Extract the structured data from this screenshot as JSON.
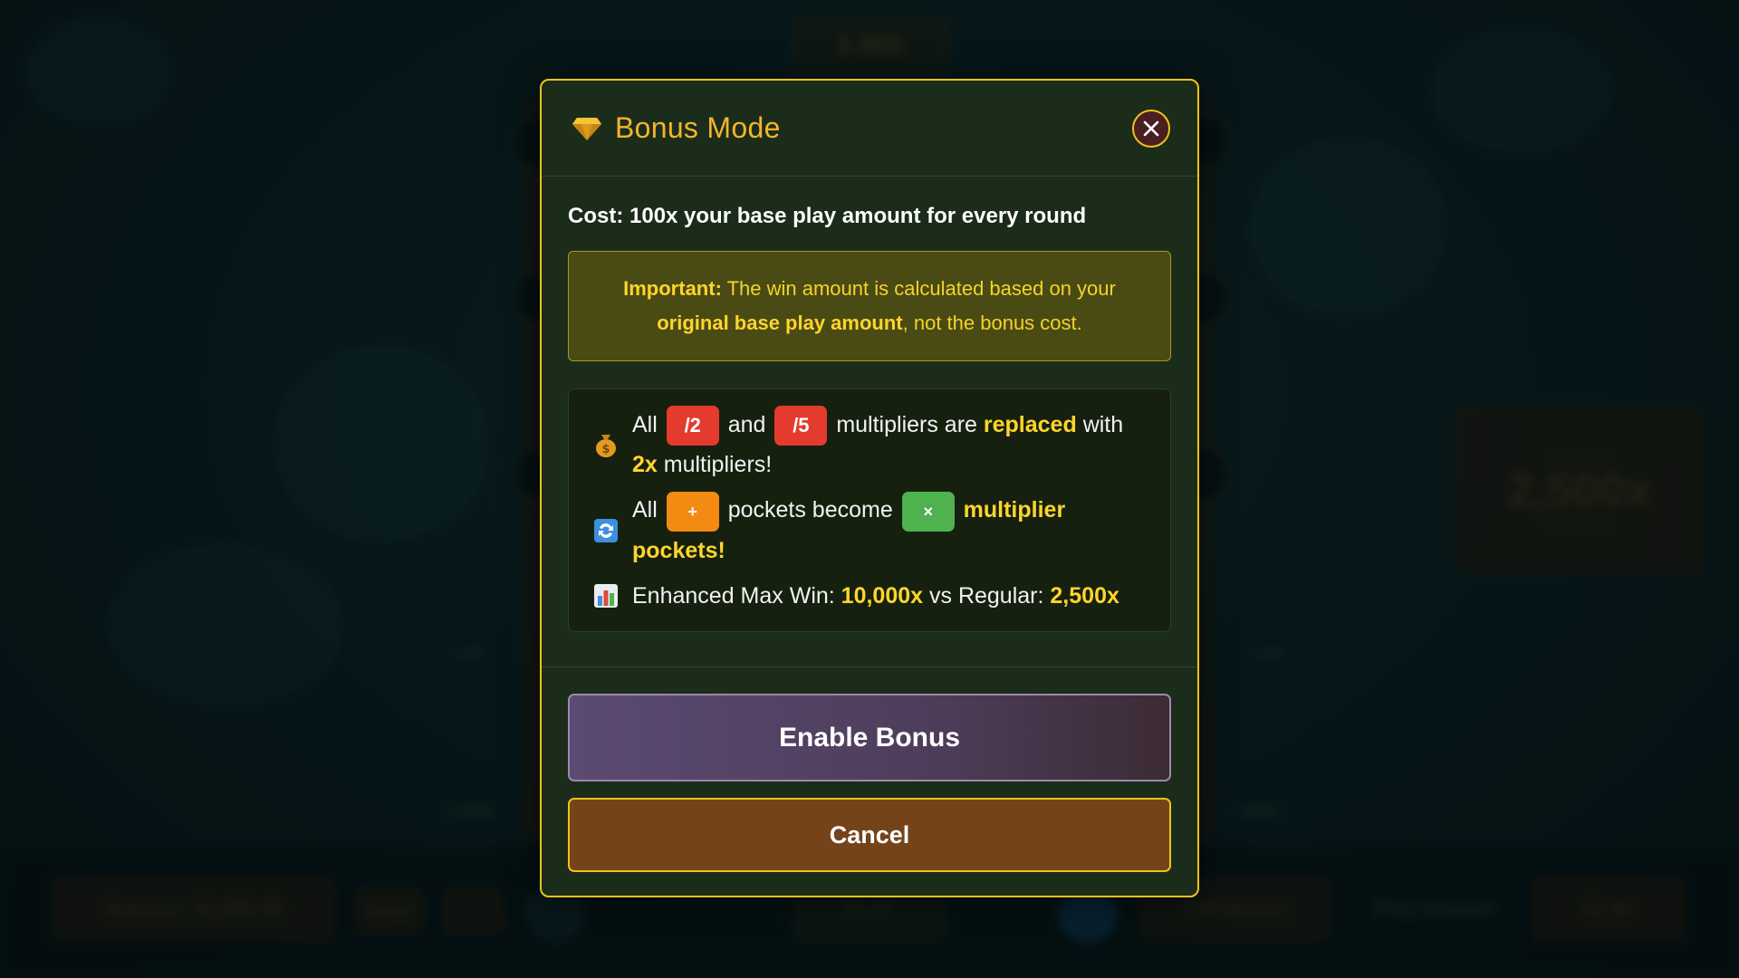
{
  "background": {
    "top_multiplier": "1.00X",
    "max_win": {
      "label": "MAX WIN",
      "value": "2,500x",
      "sub": "Regular Mode"
    },
    "labels": [
      "+15",
      "+15",
      "+1000",
      "+1000"
    ],
    "bottom_bar": {
      "balance": "Balance: $1,000.00",
      "auto": "Auto",
      "play": "PLAY",
      "get_bonus": "Get Bonus",
      "play_amount_label": "Play Amount",
      "play_amount_value": "$1.00"
    }
  },
  "modal": {
    "title": "Bonus Mode",
    "icons": {
      "title": "diamond-icon",
      "close": "close-icon"
    },
    "cost_line": "Cost: 100x your base play amount for every round",
    "important": {
      "label": "Important:",
      "text_1": " The win amount is calculated based on your ",
      "highlight": "original base play amount",
      "text_2": ", not the bonus cost."
    },
    "features": {
      "f1": {
        "icon": "money-bag-icon",
        "all": "All",
        "chip_a": "/2",
        "and": "and",
        "chip_b": "/5",
        "text": "multipliers are",
        "replaced": "replaced",
        "with": "with",
        "mult": "2x",
        "tail": "multipliers!"
      },
      "f2": {
        "icon": "swap-arrows-icon",
        "all": "All",
        "chip_a": "+",
        "text": "pockets become",
        "chip_b": "×",
        "highlight": "multiplier pockets!"
      },
      "f3": {
        "icon": "bar-chart-icon",
        "label": "Enhanced Max Win:",
        "enhanced": "10,000x",
        "vs": "vs Regular:",
        "regular": "2,500x"
      }
    },
    "enable_button": "Enable Bonus",
    "cancel_button": "Cancel"
  },
  "colors": {
    "accent_gold": "#f0c219",
    "highlight_yellow": "#ffd52b",
    "chip_red": "#e53b2e",
    "chip_orange": "#f38a12",
    "chip_green": "#4fb24f",
    "enable_purple": "#5b4a73",
    "cancel_brown": "#74431a"
  }
}
